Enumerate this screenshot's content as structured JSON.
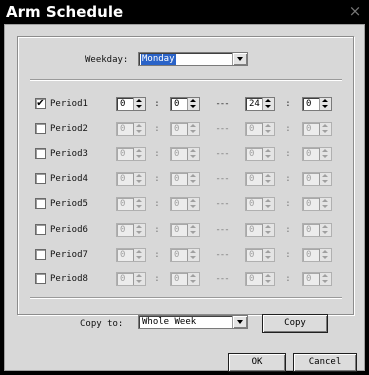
{
  "window": {
    "title": "Arm Schedule",
    "close_glyph": "×"
  },
  "weekday": {
    "label": "Weekday:",
    "selected": "Monday"
  },
  "periods": [
    {
      "label": "Period1",
      "checked": true,
      "start_h": "0",
      "start_m": "0",
      "dash": "---",
      "end_h": "24",
      "end_m": "0"
    },
    {
      "label": "Period2",
      "checked": false,
      "start_h": "0",
      "start_m": "0",
      "dash": "---",
      "end_h": "0",
      "end_m": "0"
    },
    {
      "label": "Period3",
      "checked": false,
      "start_h": "0",
      "start_m": "0",
      "dash": "---",
      "end_h": "0",
      "end_m": "0"
    },
    {
      "label": "Period4",
      "checked": false,
      "start_h": "0",
      "start_m": "0",
      "dash": "---",
      "end_h": "0",
      "end_m": "0"
    },
    {
      "label": "Period5",
      "checked": false,
      "start_h": "0",
      "start_m": "0",
      "dash": "---",
      "end_h": "0",
      "end_m": "0"
    },
    {
      "label": "Period6",
      "checked": false,
      "start_h": "0",
      "start_m": "0",
      "dash": "---",
      "end_h": "0",
      "end_m": "0"
    },
    {
      "label": "Period7",
      "checked": false,
      "start_h": "0",
      "start_m": "0",
      "dash": "---",
      "end_h": "0",
      "end_m": "0"
    },
    {
      "label": "Period8",
      "checked": false,
      "start_h": "0",
      "start_m": "0",
      "dash": "---",
      "end_h": "0",
      "end_m": "0"
    }
  ],
  "time_separator": ":",
  "copy": {
    "label": "Copy to:",
    "selected": "Whole Week",
    "button": "Copy"
  },
  "footer": {
    "ok": "OK",
    "cancel": "Cancel"
  },
  "colors": {
    "selection": "#2a63c8",
    "dialog_bg": "#d8d8d8",
    "titlebar": "#000000"
  }
}
